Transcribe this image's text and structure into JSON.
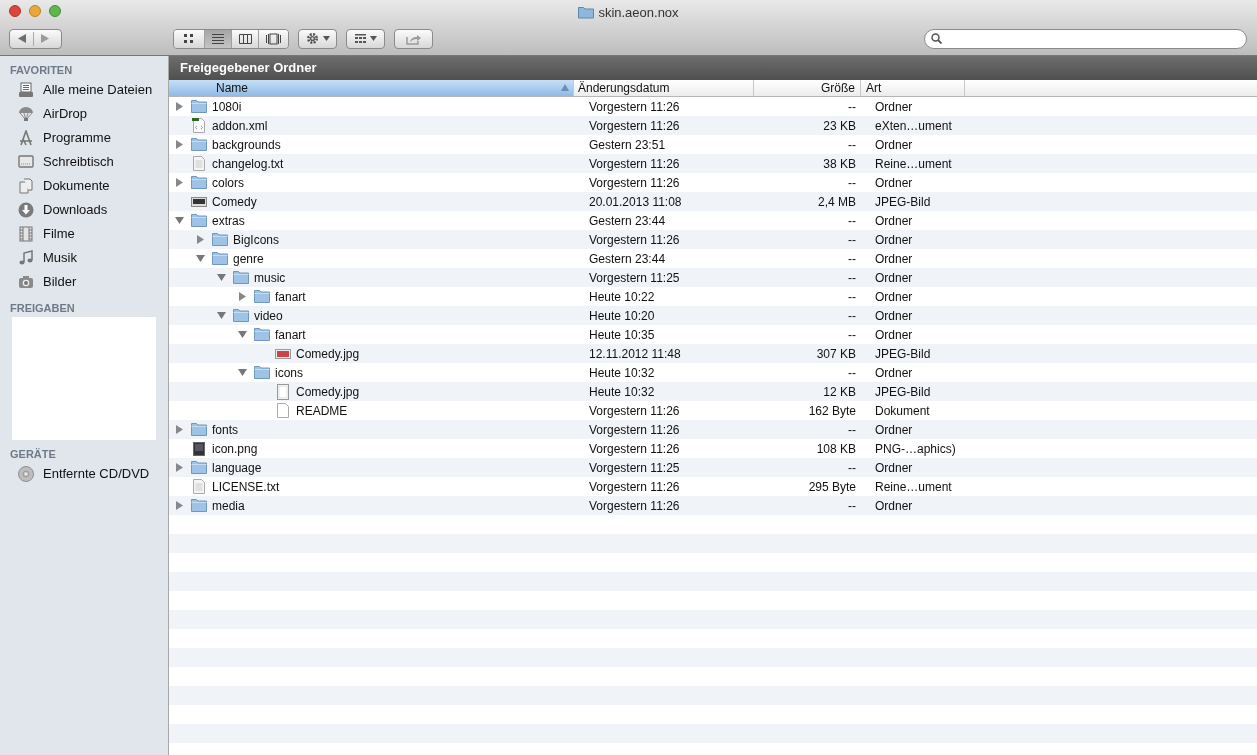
{
  "window": {
    "title": "skin.aeon.nox"
  },
  "toolbar": {
    "view_buttons": [
      {
        "kind": "icons",
        "selected": false
      },
      {
        "kind": "list",
        "selected": true
      },
      {
        "kind": "columns",
        "selected": false
      },
      {
        "kind": "coverflow",
        "selected": false
      }
    ]
  },
  "sidebar": {
    "sections": [
      {
        "title": "FAVORITEN",
        "items": [
          {
            "label": "Alle meine Dateien",
            "kind": "all"
          },
          {
            "label": "AirDrop",
            "kind": "airdrop"
          },
          {
            "label": "Programme",
            "kind": "apps"
          },
          {
            "label": "Schreibtisch",
            "kind": "desktop"
          },
          {
            "label": "Dokumente",
            "kind": "docs"
          },
          {
            "label": "Downloads",
            "kind": "downloads"
          },
          {
            "label": "Filme",
            "kind": "movies"
          },
          {
            "label": "Musik",
            "kind": "music"
          },
          {
            "label": "Bilder",
            "kind": "pictures"
          }
        ]
      },
      {
        "title": "FREIGABEN"
      },
      {
        "title": "GERÄTE",
        "items": [
          {
            "label": "Entfernte CD/DVD",
            "kind": "disc"
          }
        ]
      }
    ]
  },
  "content": {
    "title": "Freigegebener Ordner",
    "columns": [
      {
        "label": "Name",
        "sorted": true
      },
      {
        "label": "Änderungsdatum",
        "sorted": false
      },
      {
        "label": "Größe",
        "sorted": false
      },
      {
        "label": "Art",
        "sorted": false
      }
    ],
    "rows": [
      {
        "name": "1080i",
        "kind": "folder",
        "expanded": false,
        "date": "Vorgestern 11:26",
        "size": "--",
        "type": "Ordner"
      },
      {
        "name": "addon.xml",
        "kind": "xml",
        "date": "Vorgestern 11:26",
        "size": "23 KB",
        "type": "eXten…ument"
      },
      {
        "name": "backgrounds",
        "kind": "folder",
        "expanded": false,
        "date": "Gestern 23:51",
        "size": "--",
        "type": "Ordner"
      },
      {
        "name": "changelog.txt",
        "kind": "text",
        "date": "Vorgestern 11:26",
        "size": "38 KB",
        "type": "Reine…ument"
      },
      {
        "name": "colors",
        "kind": "folder",
        "expanded": false,
        "date": "Vorgestern 11:26",
        "size": "--",
        "type": "Ordner"
      },
      {
        "name": "Comedy",
        "kind": "image",
        "date": "20.01.2013 11:08",
        "size": "2,4 MB",
        "type": "JPEG-Bild"
      },
      {
        "name": "extras",
        "kind": "folder",
        "expanded": true,
        "date": "Gestern 23:44",
        "size": "--",
        "type": "Ordner",
        "children": [
          {
            "name": "BigIcons",
            "kind": "folder",
            "expanded": false,
            "date": "Vorgestern 11:26",
            "size": "--",
            "type": "Ordner"
          },
          {
            "name": "genre",
            "kind": "folder",
            "expanded": true,
            "date": "Gestern 23:44",
            "size": "--",
            "type": "Ordner",
            "children": [
              {
                "name": "music",
                "kind": "folder",
                "expanded": true,
                "date": "Vorgestern 11:25",
                "size": "--",
                "type": "Ordner",
                "children": [
                  {
                    "name": "fanart",
                    "kind": "folder",
                    "expanded": false,
                    "date": "Heute 10:22",
                    "size": "--",
                    "type": "Ordner"
                  }
                ]
              },
              {
                "name": "video",
                "kind": "folder",
                "expanded": true,
                "date": "Heute 10:20",
                "size": "--",
                "type": "Ordner",
                "children": [
                  {
                    "name": "fanart",
                    "kind": "folder",
                    "expanded": true,
                    "date": "Heute 10:35",
                    "size": "--",
                    "type": "Ordner",
                    "children": [
                      {
                        "name": "Comedy.jpg",
                        "kind": "photo",
                        "date": "12.11.2012 11:48",
                        "size": "307 KB",
                        "type": "JPEG-Bild"
                      }
                    ]
                  },
                  {
                    "name": "icons",
                    "kind": "folder",
                    "expanded": true,
                    "date": "Heute 10:32",
                    "size": "--",
                    "type": "Ordner",
                    "children": [
                      {
                        "name": "Comedy.jpg",
                        "kind": "blank",
                        "date": "Heute 10:32",
                        "size": "12 KB",
                        "type": "JPEG-Bild"
                      },
                      {
                        "name": "README",
                        "kind": "document",
                        "date": "Vorgestern 11:26",
                        "size": "162 Byte",
                        "type": "Dokument"
                      }
                    ]
                  }
                ]
              }
            ]
          }
        ]
      },
      {
        "name": "fonts",
        "kind": "folder",
        "expanded": false,
        "date": "Vorgestern 11:26",
        "size": "--",
        "type": "Ordner"
      },
      {
        "name": "icon.png",
        "kind": "png",
        "date": "Vorgestern 11:26",
        "size": "108 KB",
        "type": "PNG-…aphics)"
      },
      {
        "name": "language",
        "kind": "folder",
        "expanded": false,
        "date": "Vorgestern 11:25",
        "size": "--",
        "type": "Ordner"
      },
      {
        "name": "LICENSE.txt",
        "kind": "text",
        "date": "Vorgestern 11:26",
        "size": "295 Byte",
        "type": "Reine…ument"
      },
      {
        "name": "media",
        "kind": "folder",
        "expanded": false,
        "date": "Vorgestern 11:26",
        "size": "--",
        "type": "Ordner"
      }
    ]
  }
}
